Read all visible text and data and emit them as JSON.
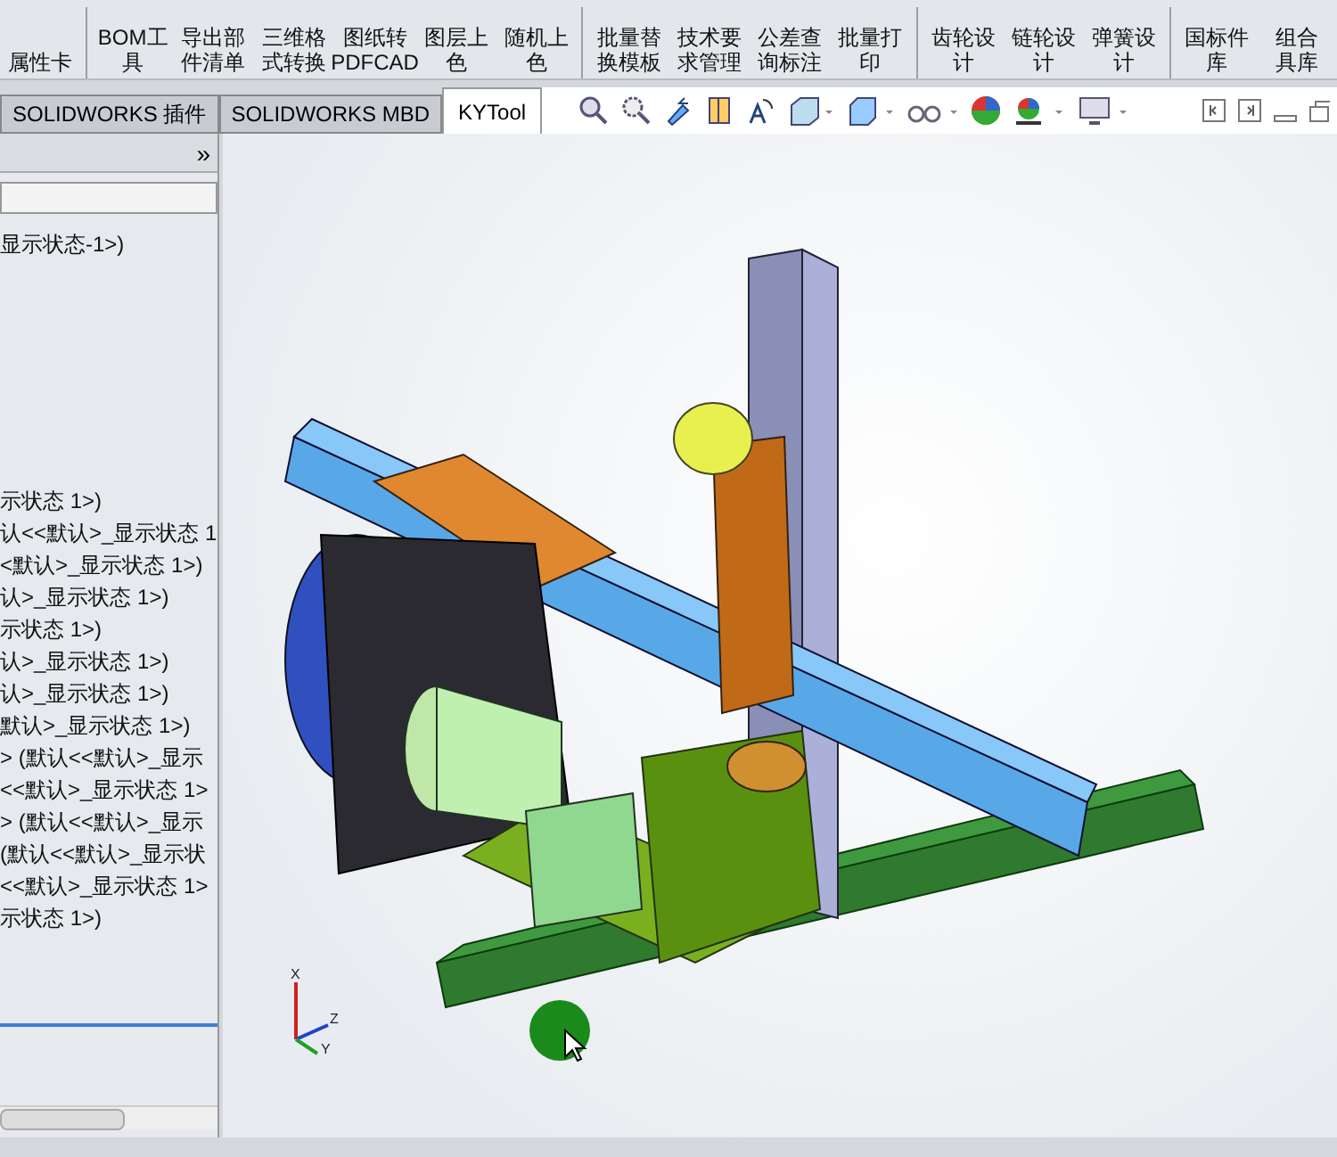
{
  "ribbon": {
    "groups": [
      [
        {
          "lines": [
            "属性卡"
          ]
        }
      ],
      [
        {
          "lines": [
            "BOM工",
            "具"
          ]
        },
        {
          "lines": [
            "导出部",
            "件清单"
          ]
        },
        {
          "lines": [
            "三维格",
            "式转换"
          ]
        },
        {
          "lines": [
            "图纸转",
            "PDFCAD"
          ]
        },
        {
          "lines": [
            "图层上",
            "色"
          ]
        },
        {
          "lines": [
            "随机上",
            "色"
          ]
        }
      ],
      [
        {
          "lines": [
            "批量替",
            "换模板"
          ]
        },
        {
          "lines": [
            "技术要",
            "求管理"
          ]
        },
        {
          "lines": [
            "公差查",
            "询标注"
          ]
        },
        {
          "lines": [
            "批量打",
            "印"
          ]
        }
      ],
      [
        {
          "lines": [
            "齿轮设",
            "计"
          ]
        },
        {
          "lines": [
            "链轮设",
            "计"
          ]
        },
        {
          "lines": [
            "弹簧设",
            "计"
          ]
        }
      ],
      [
        {
          "lines": [
            "国标件",
            "库"
          ]
        },
        {
          "lines": [
            "组合",
            "具库"
          ]
        }
      ]
    ]
  },
  "tabs": [
    {
      "label": "SOLIDWORKS 插件",
      "selected": false
    },
    {
      "label": "SOLIDWORKS MBD",
      "selected": false
    },
    {
      "label": "KYTool",
      "selected": true
    }
  ],
  "feature_tree": {
    "expand_glyph": "»",
    "lines": [
      "显示状态-1>)",
      "示状态 1>)",
      "认<<默认>_显示状态 1",
      "<默认>_显示状态 1>)",
      "认>_显示状态 1>)",
      "示状态 1>)",
      "认>_显示状态 1>)",
      "认>_显示状态 1>)",
      "默认>_显示状态 1>)",
      "> (默认<<默认>_显示",
      "<<默认>_显示状态 1>",
      "> (默认<<默认>_显示",
      "(默认<<默认>_显示状",
      "<<默认>_显示状态 1>",
      "示状态 1>)"
    ]
  },
  "triad": {
    "labels": [
      "X",
      "Z",
      "Y"
    ]
  }
}
